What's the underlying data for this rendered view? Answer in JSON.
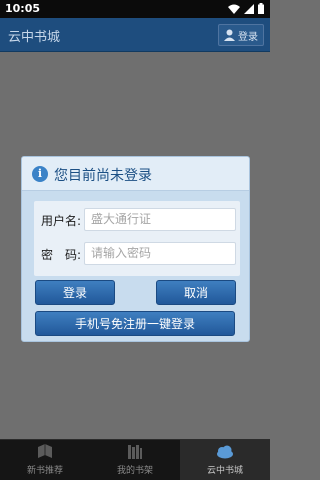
{
  "status": {
    "time": "10:05"
  },
  "appbar": {
    "title": "云中书城",
    "login_label": "登录"
  },
  "dialog": {
    "title": "您目前尚未登录",
    "username_label": "用户名:",
    "username_placeholder": "盛大通行证",
    "password_label": "密　码:",
    "password_placeholder": "请输入密码",
    "login_button": "登录",
    "cancel_button": "取消",
    "phone_button": "手机号免注册一键登录"
  },
  "tabs": [
    {
      "label": "新书推荐",
      "icon": "books-icon"
    },
    {
      "label": "我的书架",
      "icon": "bookshelf-icon"
    },
    {
      "label": "云中书城",
      "icon": "cloud-icon",
      "active": true
    }
  ],
  "colors": {
    "appbar": "#1e4d7e",
    "dialog": "#c8dcee",
    "button": "#2a64a6"
  }
}
